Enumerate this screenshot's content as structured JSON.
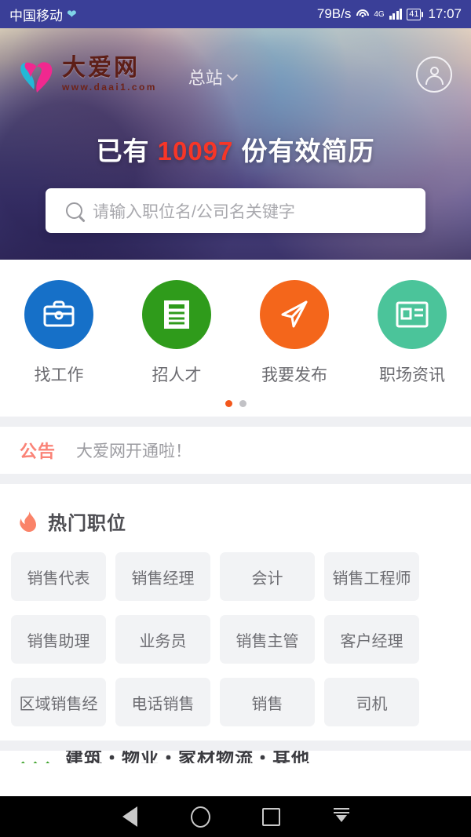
{
  "statusbar": {
    "carrier": "中国移动",
    "carrier_icon": "heart-icon",
    "netspeed": "79B/s",
    "wifi_icon": "wifi-icon",
    "network_type": "4G",
    "signal_icon": "signal-bars-icon",
    "battery_level": "41",
    "time": "17:07",
    "bg_color": "#3a3f98"
  },
  "hero": {
    "logo": {
      "name": "大爱网",
      "url": "www.daai1.com",
      "icon": "heart-logo-icon",
      "heart_cyan": "#29b7d4",
      "heart_magenta": "#ea2a8c",
      "text_color": "#5b1f18"
    },
    "site_selector": {
      "label": "总站",
      "chevron": "chevron-down-icon"
    },
    "account_icon": "user-account-icon",
    "headline": {
      "prefix": "已有",
      "number": "10097",
      "suffix": "份有效简历",
      "number_color": "#f0382a"
    },
    "search": {
      "icon": "search-icon",
      "placeholder": "请输入职位名/公司名关键字",
      "value": ""
    }
  },
  "quick_actions": {
    "items": [
      {
        "label": "找工作",
        "icon": "briefcase-icon",
        "color": "#1670c8"
      },
      {
        "label": "招人才",
        "icon": "document-lines-icon",
        "color": "#2f9b1b"
      },
      {
        "label": "我要发布",
        "icon": "paper-plane-icon",
        "color": "#f4661b"
      },
      {
        "label": "职场资讯",
        "icon": "news-card-icon",
        "color": "#4bc49a"
      }
    ],
    "pager": {
      "count": 2,
      "active_index": 0,
      "active_color": "#f3571c",
      "inactive_color": "#c2c2c6"
    }
  },
  "announcement": {
    "tag": "公告",
    "tag_color": "#fa8377",
    "text": "大爱网开通啦！"
  },
  "hot_jobs": {
    "icon": "flame-icon",
    "icon_color": "#fa8369",
    "title": "热门职位",
    "tags": [
      "销售代表",
      "销售经理",
      "会计",
      "销售工程师",
      "销售助理",
      "业务员",
      "销售主管",
      "客户经理",
      "区域销售经",
      "电话销售",
      "销售",
      "司机"
    ]
  },
  "next_section": {
    "icon": "sprout-icon",
    "icon_color": "#3ea32b",
    "title": "建筑・物业・家材物流・其他"
  },
  "navbar": {
    "back_icon": "back-triangle-icon",
    "home_icon": "home-circle-icon",
    "recents_icon": "recents-square-icon",
    "hide_icon": "hide-keyboard-icon",
    "bg_color": "#000000"
  }
}
